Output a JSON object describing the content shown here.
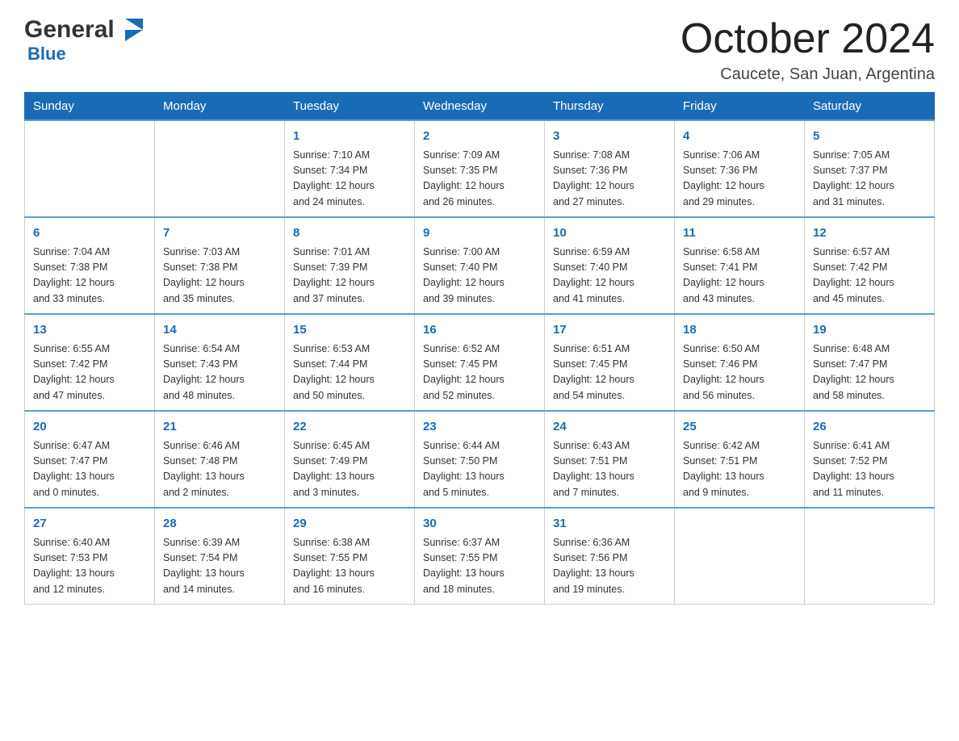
{
  "header": {
    "logo_general": "General",
    "logo_blue": "Blue",
    "month_title": "October 2024",
    "location": "Caucete, San Juan, Argentina"
  },
  "weekdays": [
    "Sunday",
    "Monday",
    "Tuesday",
    "Wednesday",
    "Thursday",
    "Friday",
    "Saturday"
  ],
  "weeks": [
    [
      {
        "day": "",
        "info": ""
      },
      {
        "day": "",
        "info": ""
      },
      {
        "day": "1",
        "info": "Sunrise: 7:10 AM\nSunset: 7:34 PM\nDaylight: 12 hours\nand 24 minutes."
      },
      {
        "day": "2",
        "info": "Sunrise: 7:09 AM\nSunset: 7:35 PM\nDaylight: 12 hours\nand 26 minutes."
      },
      {
        "day": "3",
        "info": "Sunrise: 7:08 AM\nSunset: 7:36 PM\nDaylight: 12 hours\nand 27 minutes."
      },
      {
        "day": "4",
        "info": "Sunrise: 7:06 AM\nSunset: 7:36 PM\nDaylight: 12 hours\nand 29 minutes."
      },
      {
        "day": "5",
        "info": "Sunrise: 7:05 AM\nSunset: 7:37 PM\nDaylight: 12 hours\nand 31 minutes."
      }
    ],
    [
      {
        "day": "6",
        "info": "Sunrise: 7:04 AM\nSunset: 7:38 PM\nDaylight: 12 hours\nand 33 minutes."
      },
      {
        "day": "7",
        "info": "Sunrise: 7:03 AM\nSunset: 7:38 PM\nDaylight: 12 hours\nand 35 minutes."
      },
      {
        "day": "8",
        "info": "Sunrise: 7:01 AM\nSunset: 7:39 PM\nDaylight: 12 hours\nand 37 minutes."
      },
      {
        "day": "9",
        "info": "Sunrise: 7:00 AM\nSunset: 7:40 PM\nDaylight: 12 hours\nand 39 minutes."
      },
      {
        "day": "10",
        "info": "Sunrise: 6:59 AM\nSunset: 7:40 PM\nDaylight: 12 hours\nand 41 minutes."
      },
      {
        "day": "11",
        "info": "Sunrise: 6:58 AM\nSunset: 7:41 PM\nDaylight: 12 hours\nand 43 minutes."
      },
      {
        "day": "12",
        "info": "Sunrise: 6:57 AM\nSunset: 7:42 PM\nDaylight: 12 hours\nand 45 minutes."
      }
    ],
    [
      {
        "day": "13",
        "info": "Sunrise: 6:55 AM\nSunset: 7:42 PM\nDaylight: 12 hours\nand 47 minutes."
      },
      {
        "day": "14",
        "info": "Sunrise: 6:54 AM\nSunset: 7:43 PM\nDaylight: 12 hours\nand 48 minutes."
      },
      {
        "day": "15",
        "info": "Sunrise: 6:53 AM\nSunset: 7:44 PM\nDaylight: 12 hours\nand 50 minutes."
      },
      {
        "day": "16",
        "info": "Sunrise: 6:52 AM\nSunset: 7:45 PM\nDaylight: 12 hours\nand 52 minutes."
      },
      {
        "day": "17",
        "info": "Sunrise: 6:51 AM\nSunset: 7:45 PM\nDaylight: 12 hours\nand 54 minutes."
      },
      {
        "day": "18",
        "info": "Sunrise: 6:50 AM\nSunset: 7:46 PM\nDaylight: 12 hours\nand 56 minutes."
      },
      {
        "day": "19",
        "info": "Sunrise: 6:48 AM\nSunset: 7:47 PM\nDaylight: 12 hours\nand 58 minutes."
      }
    ],
    [
      {
        "day": "20",
        "info": "Sunrise: 6:47 AM\nSunset: 7:47 PM\nDaylight: 13 hours\nand 0 minutes."
      },
      {
        "day": "21",
        "info": "Sunrise: 6:46 AM\nSunset: 7:48 PM\nDaylight: 13 hours\nand 2 minutes."
      },
      {
        "day": "22",
        "info": "Sunrise: 6:45 AM\nSunset: 7:49 PM\nDaylight: 13 hours\nand 3 minutes."
      },
      {
        "day": "23",
        "info": "Sunrise: 6:44 AM\nSunset: 7:50 PM\nDaylight: 13 hours\nand 5 minutes."
      },
      {
        "day": "24",
        "info": "Sunrise: 6:43 AM\nSunset: 7:51 PM\nDaylight: 13 hours\nand 7 minutes."
      },
      {
        "day": "25",
        "info": "Sunrise: 6:42 AM\nSunset: 7:51 PM\nDaylight: 13 hours\nand 9 minutes."
      },
      {
        "day": "26",
        "info": "Sunrise: 6:41 AM\nSunset: 7:52 PM\nDaylight: 13 hours\nand 11 minutes."
      }
    ],
    [
      {
        "day": "27",
        "info": "Sunrise: 6:40 AM\nSunset: 7:53 PM\nDaylight: 13 hours\nand 12 minutes."
      },
      {
        "day": "28",
        "info": "Sunrise: 6:39 AM\nSunset: 7:54 PM\nDaylight: 13 hours\nand 14 minutes."
      },
      {
        "day": "29",
        "info": "Sunrise: 6:38 AM\nSunset: 7:55 PM\nDaylight: 13 hours\nand 16 minutes."
      },
      {
        "day": "30",
        "info": "Sunrise: 6:37 AM\nSunset: 7:55 PM\nDaylight: 13 hours\nand 18 minutes."
      },
      {
        "day": "31",
        "info": "Sunrise: 6:36 AM\nSunset: 7:56 PM\nDaylight: 13 hours\nand 19 minutes."
      },
      {
        "day": "",
        "info": ""
      },
      {
        "day": "",
        "info": ""
      }
    ]
  ]
}
